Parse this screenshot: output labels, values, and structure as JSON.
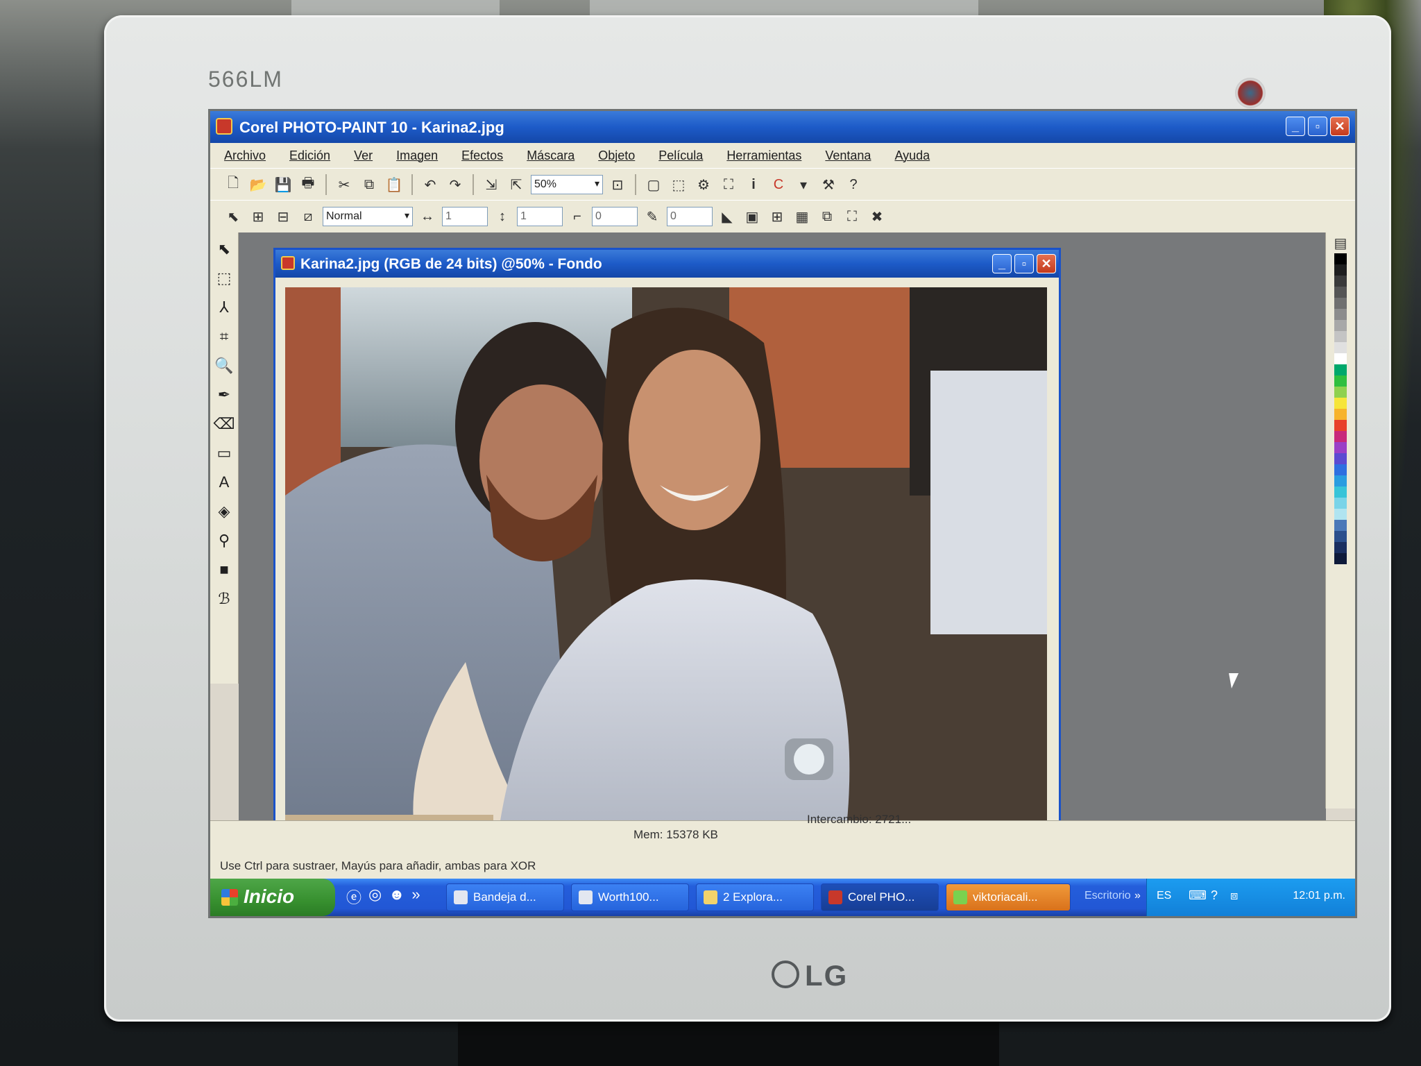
{
  "monitor": {
    "model": "566LM",
    "brand": "LG"
  },
  "app": {
    "title": "Corel PHOTO-PAINT 10 - Karina2.jpg",
    "window_buttons": {
      "minimize": "_",
      "maximize": "▫",
      "close": "✕"
    }
  },
  "menu": {
    "items": [
      "Archivo",
      "Edición",
      "Ver",
      "Imagen",
      "Efectos",
      "Máscara",
      "Objeto",
      "Película",
      "Herramientas",
      "Ventana",
      "Ayuda"
    ]
  },
  "toolbar": {
    "zoom_value": "50%",
    "mode_value": "Normal",
    "spin1": "1",
    "spin2": "1",
    "spin3": "0",
    "spin4": "0",
    "info_icon": "i"
  },
  "document": {
    "title": "Karina2.jpg (RGB de 24 bits) @50% - Fondo"
  },
  "status": {
    "memory": "Mem: 15378 KB",
    "swap": "Intercambio: 2721...",
    "hint": "Use Ctrl para sustraer, Mayús para añadir, ambas para XOR"
  },
  "taskbar": {
    "start_label": "Inicio",
    "quick_more": "»",
    "tasks": [
      {
        "label": "Bandeja d..."
      },
      {
        "label": "Worth100..."
      },
      {
        "label": "2 Explora..."
      },
      {
        "label": "Corel PHO..."
      },
      {
        "label": "viktoriacali..."
      }
    ],
    "desktop_label": "Escritorio",
    "tray_more": "»",
    "language": "ES",
    "clock": "12:01 p.m."
  },
  "colors": {
    "xp_blue": "#1d5bc8",
    "start_green": "#37902f",
    "workspace_gray": "#77797b",
    "highlight_task": "#d9711b"
  },
  "palette_colors": [
    "#000000",
    "#1e1e1e",
    "#3a3a3a",
    "#555555",
    "#707070",
    "#8c8c8c",
    "#a8a8a8",
    "#c4c4c4",
    "#e0e0e0",
    "#ffffff",
    "#00a86b",
    "#2fbf3f",
    "#8fd14f",
    "#f6e53a",
    "#f7b32b",
    "#e8402a",
    "#c8287a",
    "#9b3fc6",
    "#5c4ad1",
    "#2f6fe0",
    "#2a9de0",
    "#38c4d8",
    "#7ad4e8",
    "#b0e4f0",
    "#4a78b8",
    "#2b4f8c",
    "#1a2f60",
    "#0e1a3a"
  ]
}
